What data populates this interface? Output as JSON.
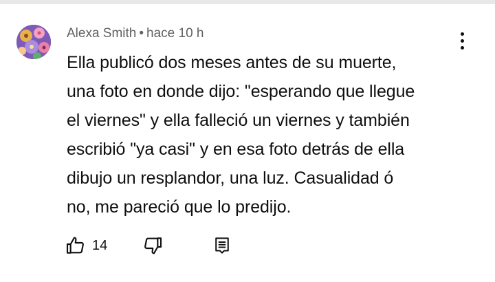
{
  "comment": {
    "author": "Alexa Smith",
    "separator": "•",
    "time": "hace 10 h",
    "lines": [
      "Ella publicó dos meses antes de su muerte,",
      "una foto en donde dijo: \"esperando que llegue",
      "el viernes\" y ella falleció un viernes y también",
      "escribió \"ya casi\" y en esa foto detrás de ella",
      "dibujo un resplandor, una luz. Casualidad ó",
      "no, me pareció que lo predijo."
    ],
    "like_count": "14"
  },
  "icons": {
    "avatar": "flowers-avatar",
    "menu": "more-vertical-icon",
    "like": "thumbs-up-icon",
    "dislike": "thumbs-down-icon",
    "reply": "comment-reply-icon"
  },
  "colors": {
    "text": "#0f0f0f",
    "meta": "#606060",
    "divider": "#e8e8e8"
  }
}
